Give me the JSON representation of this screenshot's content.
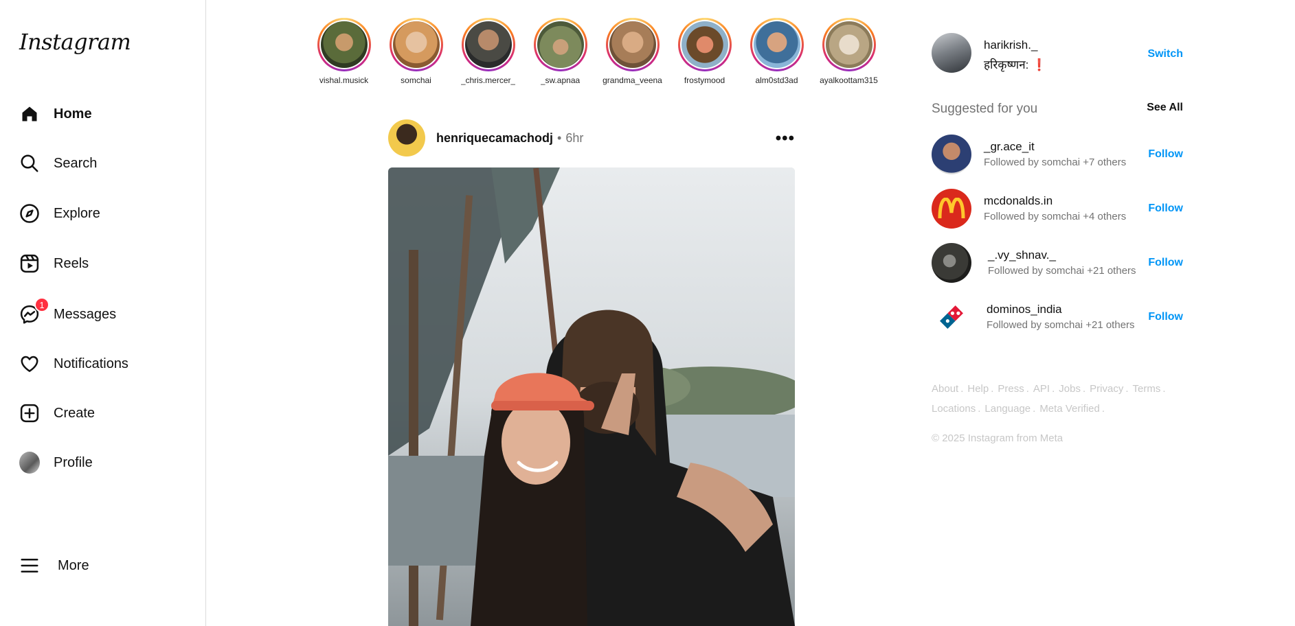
{
  "logo": "Instagram",
  "nav": {
    "home": "Home",
    "search": "Search",
    "explore": "Explore",
    "reels": "Reels",
    "messages": "Messages",
    "messages_badge": "1",
    "notifications": "Notifications",
    "create": "Create",
    "profile": "Profile",
    "more": "More"
  },
  "stories": [
    {
      "name": "vishal.musick"
    },
    {
      "name": "somchai"
    },
    {
      "name": "_chris.mercer_"
    },
    {
      "name": "_sw.apnaa"
    },
    {
      "name": "grandma_veena"
    },
    {
      "name": "frostymood"
    },
    {
      "name": "alm0std3ad"
    },
    {
      "name": "ayalkoottam315"
    }
  ],
  "post": {
    "username": "henriquecamachodj",
    "separator": "•",
    "time": "6hr",
    "more_glyph": "•••"
  },
  "current_user": {
    "username": "harikrish._",
    "display_name": "हरिकृष्णन: ❗",
    "switch_label": "Switch"
  },
  "suggestions": {
    "title": "Suggested for you",
    "see_all": "See All",
    "items": [
      {
        "username": "_gr.ace_it",
        "subtitle": "Followed by somchai +7 others",
        "action": "Follow"
      },
      {
        "username": "mcdonalds.in",
        "subtitle": "Followed by somchai +4 others",
        "action": "Follow"
      },
      {
        "username": "_.vy_shnav._",
        "subtitle": "Followed by somchai +21 others",
        "action": "Follow"
      },
      {
        "username": "dominos_india",
        "subtitle": "Followed by somchai +21 others",
        "action": "Follow"
      }
    ]
  },
  "footer": {
    "links_line1": [
      "About",
      "Help",
      "Press",
      "API",
      "Jobs",
      "Privacy",
      "Terms"
    ],
    "links_line2": [
      "Locations",
      "Language",
      "Meta Verified"
    ],
    "separator": ".",
    "copyright": "© 2025 Instagram from Meta"
  },
  "colors": {
    "link_blue": "#0095f6",
    "badge_red": "#ff3040",
    "muted": "#737373",
    "footer_gray": "#c7c7c7",
    "mcdonalds_red": "#da291c",
    "mcdonalds_yellow": "#ffc72c",
    "dominos_blue": "#006491",
    "dominos_red": "#e31837"
  }
}
